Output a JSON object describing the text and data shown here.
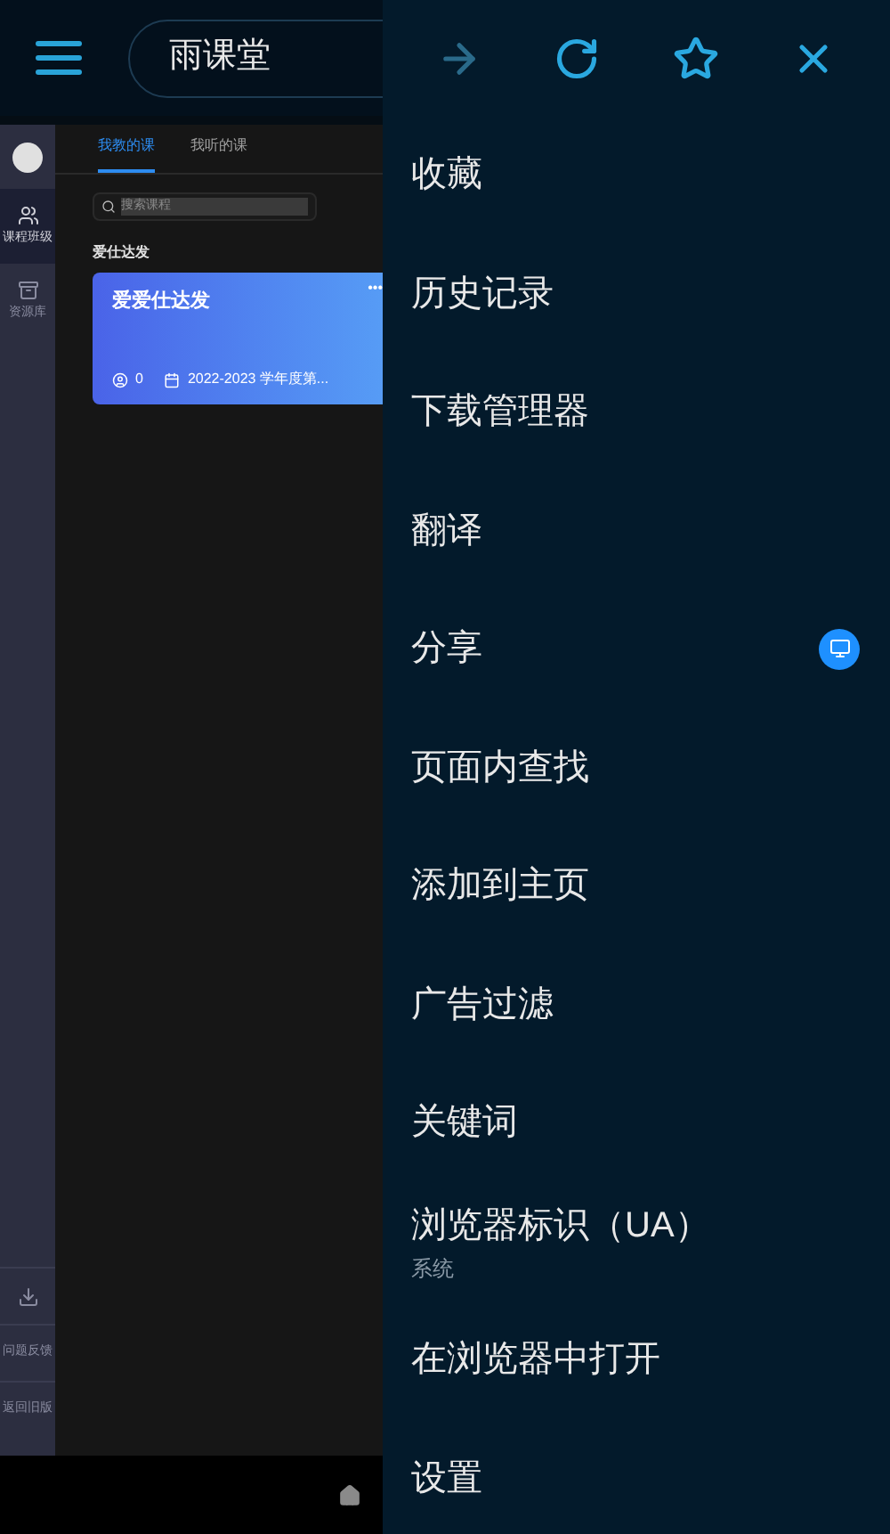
{
  "browser_bar": {
    "title": "雨课堂"
  },
  "sidebar": {
    "items": [
      {
        "kind": "avatar"
      },
      {
        "kind": "nav",
        "label": "课程班级",
        "selected": true
      },
      {
        "kind": "nav",
        "label": "资源库",
        "selected": false
      }
    ],
    "bottom_items": [
      {
        "kind": "icon"
      },
      {
        "kind": "link",
        "label": "问题反馈"
      },
      {
        "kind": "link",
        "label": "返回旧版"
      }
    ]
  },
  "tabs": [
    {
      "label": "我教的课",
      "selected": true
    },
    {
      "label": "我听的课",
      "selected": false
    }
  ],
  "search": {
    "placeholder": "搜索课程"
  },
  "section_title": "爱仕达发",
  "course_card": {
    "title": "爱爱仕达发",
    "more": "•••",
    "students": "0",
    "term": "2022-2023 学年度第..."
  },
  "drawer": {
    "toolbar": [
      {
        "disabled": true
      },
      {
        "disabled": false
      },
      {
        "disabled": false
      },
      {
        "disabled": false
      }
    ],
    "menu": [
      {
        "label": "收藏"
      },
      {
        "label": "历史记录"
      },
      {
        "label": "下载管理器"
      },
      {
        "label": "翻译"
      },
      {
        "label": "分享",
        "has_badge": true
      },
      {
        "label": "页面内查找"
      },
      {
        "label": "添加到主页"
      },
      {
        "label": "广告过滤"
      },
      {
        "label": "关键词"
      },
      {
        "label": "浏览器标识（UA）",
        "subtitle": "系统"
      },
      {
        "label": "在浏览器中打开"
      },
      {
        "label": "设置"
      }
    ]
  }
}
